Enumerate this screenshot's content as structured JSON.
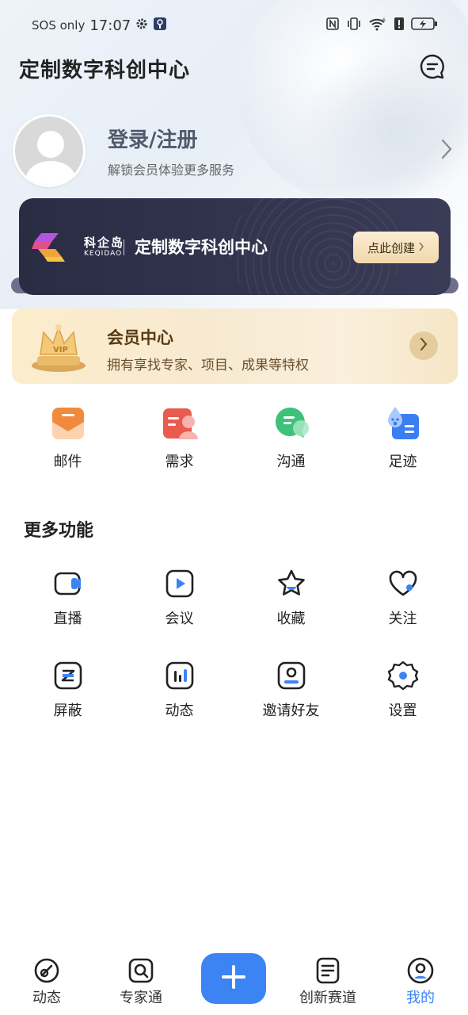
{
  "status_bar": {
    "carrier": "SOS only",
    "time": "17:07",
    "left_icons": [
      "gear-icon",
      "app-notification-icon"
    ],
    "right_icons": [
      "nfc-icon",
      "vibrate-icon",
      "wifi-6-icon",
      "alert-icon",
      "battery-charging-icon"
    ]
  },
  "header": {
    "title": "定制数字科创中心",
    "message_icon": "message-bubble-icon"
  },
  "profile": {
    "login_label": "登录/注册",
    "subtitle": "解锁会员体验更多服务"
  },
  "banner": {
    "brand_cn": "科企岛",
    "brand_en": "KEQIDAO",
    "title": "定制数字科创中心",
    "button_label": "点此创建"
  },
  "vip_card": {
    "title": "会员中心",
    "subtitle": "拥有享找专家、项目、成果等特权"
  },
  "quick_actions": [
    {
      "label": "邮件",
      "icon": "mail-icon"
    },
    {
      "label": "需求",
      "icon": "demand-icon"
    },
    {
      "label": "沟通",
      "icon": "chat-icon"
    },
    {
      "label": "足迹",
      "icon": "footprint-icon"
    }
  ],
  "more_section": {
    "title": "更多功能",
    "items": [
      {
        "label": "直播",
        "icon": "live-camera-icon"
      },
      {
        "label": "会议",
        "icon": "meeting-play-icon"
      },
      {
        "label": "收藏",
        "icon": "star-icon"
      },
      {
        "label": "关注",
        "icon": "heart-icon"
      },
      {
        "label": "屏蔽",
        "icon": "block-icon"
      },
      {
        "label": "动态",
        "icon": "activity-chart-icon"
      },
      {
        "label": "邀请好友",
        "icon": "invite-friend-icon"
      },
      {
        "label": "设置",
        "icon": "settings-gear-icon"
      }
    ]
  },
  "tab_bar": {
    "tabs": [
      {
        "label": "动态",
        "icon": "feed-icon",
        "active": false
      },
      {
        "label": "专家通",
        "icon": "expert-search-icon",
        "active": false
      },
      {
        "label": "创新赛道",
        "icon": "innovation-track-icon",
        "active": false
      },
      {
        "label": "我的",
        "icon": "profile-icon",
        "active": true
      }
    ],
    "center_button_icon": "plus-icon"
  },
  "colors": {
    "accent": "#3c84f4",
    "banner_bg": "#2f3149",
    "vip_bg": "#fbeccb",
    "vip_text": "#5a3b12"
  }
}
